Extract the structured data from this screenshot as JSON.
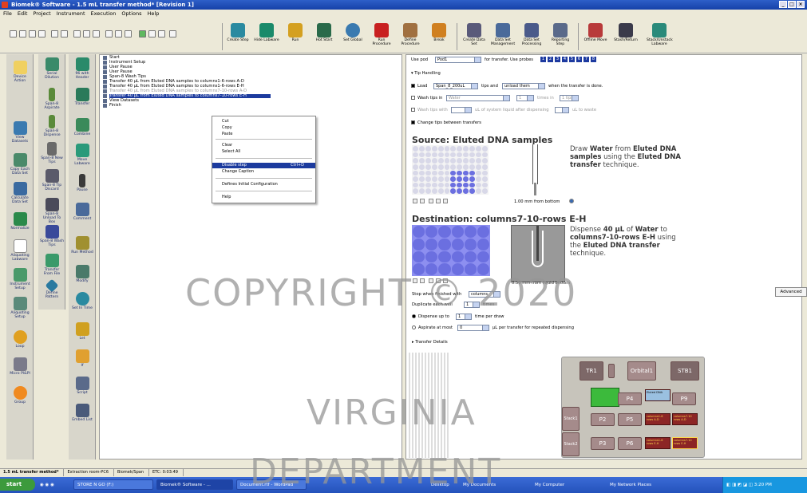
{
  "title": "Biomek® Software - 1.5 mL transfer method* [Revision 1]",
  "menu": [
    "File",
    "Edit",
    "Project",
    "Instrument",
    "Execution",
    "Options",
    "Help"
  ],
  "toolbar": {
    "big": [
      "Create Step",
      "Hide Labware",
      "Run",
      "Hot Start",
      "Set Global",
      "Run Procedure",
      "Define Procedure",
      "Break",
      "Create Data Set",
      "Data Set Management",
      "Data Set Processing",
      "Reporting Step",
      "Offline Move",
      "Stash/Return",
      "Stack/Unstack Labware"
    ]
  },
  "left1": [
    "Device Action",
    "View Datasets",
    "Copy Each Data Set",
    "Calculate Data Set",
    "Normalize",
    "Aliquoting Labware",
    "Instrument Setup",
    "Aliquoting Setup",
    "Loop",
    "Micro Pl&Pl",
    "Group"
  ],
  "left2": [
    "Serial Dilution",
    "Span-8 Aspirate",
    "Span-8 Dispense",
    "Span-8 New Tips",
    "Span-8 Tip Discard",
    "Span-8 Unload To Box",
    "Span-8 Wash Tips",
    "Transfer From File",
    "Define Pattern"
  ],
  "left3": [
    "96 with Header",
    "Transfer",
    "Combine",
    "Move Labware",
    "Pause",
    "Comment",
    "Run Method",
    "Modify",
    "Set In Time",
    "Let",
    "If",
    "Script",
    "Embed List"
  ],
  "tree": {
    "rows": [
      "Start",
      "Instrument Setup",
      "User Pause",
      "User Pause",
      "Span-8 Wash Tips",
      "Transfer 40 µL from Eluted DNA samples to columns1-6-rows A-D",
      "Transfer 40 µL from Eluted DNA samples to columns1-6-rows E-H",
      "Transfer 40 µL from Eluted DNA samples to columns7-10-rows A-D",
      "Transfer 40 µL from Eluted DNA samples to columns7-10-rows E-H",
      "View Datasets",
      "Finish"
    ]
  },
  "context_menu": {
    "items": [
      "Cut",
      "Copy",
      "Paste",
      "Clear",
      "Select All",
      "Disable step",
      "Change Caption",
      "Defines Initial Configuration",
      "Help"
    ],
    "shortcut": "Ctrl+D"
  },
  "props": {
    "use_pod_label": "Use pod",
    "use_pod_value": "Pod1",
    "for_transfer": "for transfer.",
    "use_probes": "Use probes",
    "probes": [
      "1",
      "2",
      "3",
      "4",
      "5",
      "6",
      "7",
      "8"
    ],
    "tip_handling": "Tip Handling",
    "load": "Load",
    "load_value": "Span_8_200uL",
    "tips_and": "tips and",
    "unload_value": "unload them",
    "when_done": "when the transfer is done.",
    "wash_tips_in": "Wash tips in",
    "wash_value": "Water",
    "wash_times_value": "1",
    "wash_times": "times in",
    "wash_amount": "1 tips",
    "wash_tips_with": "Wash tips with",
    "wash_tips_with_tail": "uL of system liquid after dispensing",
    "to_waste": "uL to waste",
    "change_tips": "Change tips between transfers",
    "source_title": "Source: Eluted DNA samples",
    "source_desc": [
      "Draw ",
      "Water",
      " from ",
      "Eluted DNA samples",
      " using the ",
      "Eluted DNA transfer",
      " technique."
    ],
    "from_bottom": "1.00 mm from bottom",
    "dest_title": "Destination: columns7-10-rows E-H",
    "dest_desc": [
      "Dispense ",
      "40 µL",
      " of ",
      "Water",
      " to ",
      "columns7-10-rows E-H",
      " using the ",
      "Eluted DNA transfer",
      " technique."
    ],
    "from_top": "0.50 mm from liquid bottom",
    "stop_when": "Stop when finished with",
    "stop_value": "columns",
    "duplicate": "Duplicate each well",
    "dup_value": "1",
    "times": "times",
    "dispense_up_to": "Dispense up to",
    "disp_value": "1",
    "time_per_draw": "time per draw",
    "aspirate_at_most": "Aspirate at most",
    "asp_value": "0",
    "asp_tail": "µL per transfer for repeated dispensing",
    "transfer_details": "Transfer Details",
    "advanced": "Advanced"
  },
  "deck": {
    "tr1": "TR1",
    "orbital": "Orbital1",
    "stb1": "STB1",
    "p4": "P4",
    "p9": "P9",
    "p2": "P2",
    "p5": "P5",
    "p3": "P3",
    "p6": "P6",
    "stack1": "Stack1",
    "stack2": "Stack2",
    "eluted": "Eluted DNA",
    "cols1": "columns1-6",
    "cols7": "columns7-10",
    "rowsa": "rows A-D",
    "rowse": "rows E-H"
  },
  "statusbar": [
    "1.5 mL transfer method*",
    "Extraction room-PC6",
    "Biomek/Span",
    "ETC: 0:03:49"
  ],
  "taskbar": {
    "start": "start",
    "items": [
      "STORE N GO (F:)",
      "Biomek® Software - ...",
      "Document.rtf - WordPad"
    ],
    "desktop": [
      "Desktop",
      "My Documents",
      "My Computer",
      "My Network Places"
    ],
    "clock": "3:20 PM"
  },
  "watermarks": {
    "copyright": "COPYRIGHT © 2020",
    "virginia": "VIRGINIA",
    "department": "DEPARTMENT"
  },
  "colors": {
    "accent": "#1c3b9e",
    "plate": "#6b6fe0",
    "title": "#2e5fc8"
  }
}
